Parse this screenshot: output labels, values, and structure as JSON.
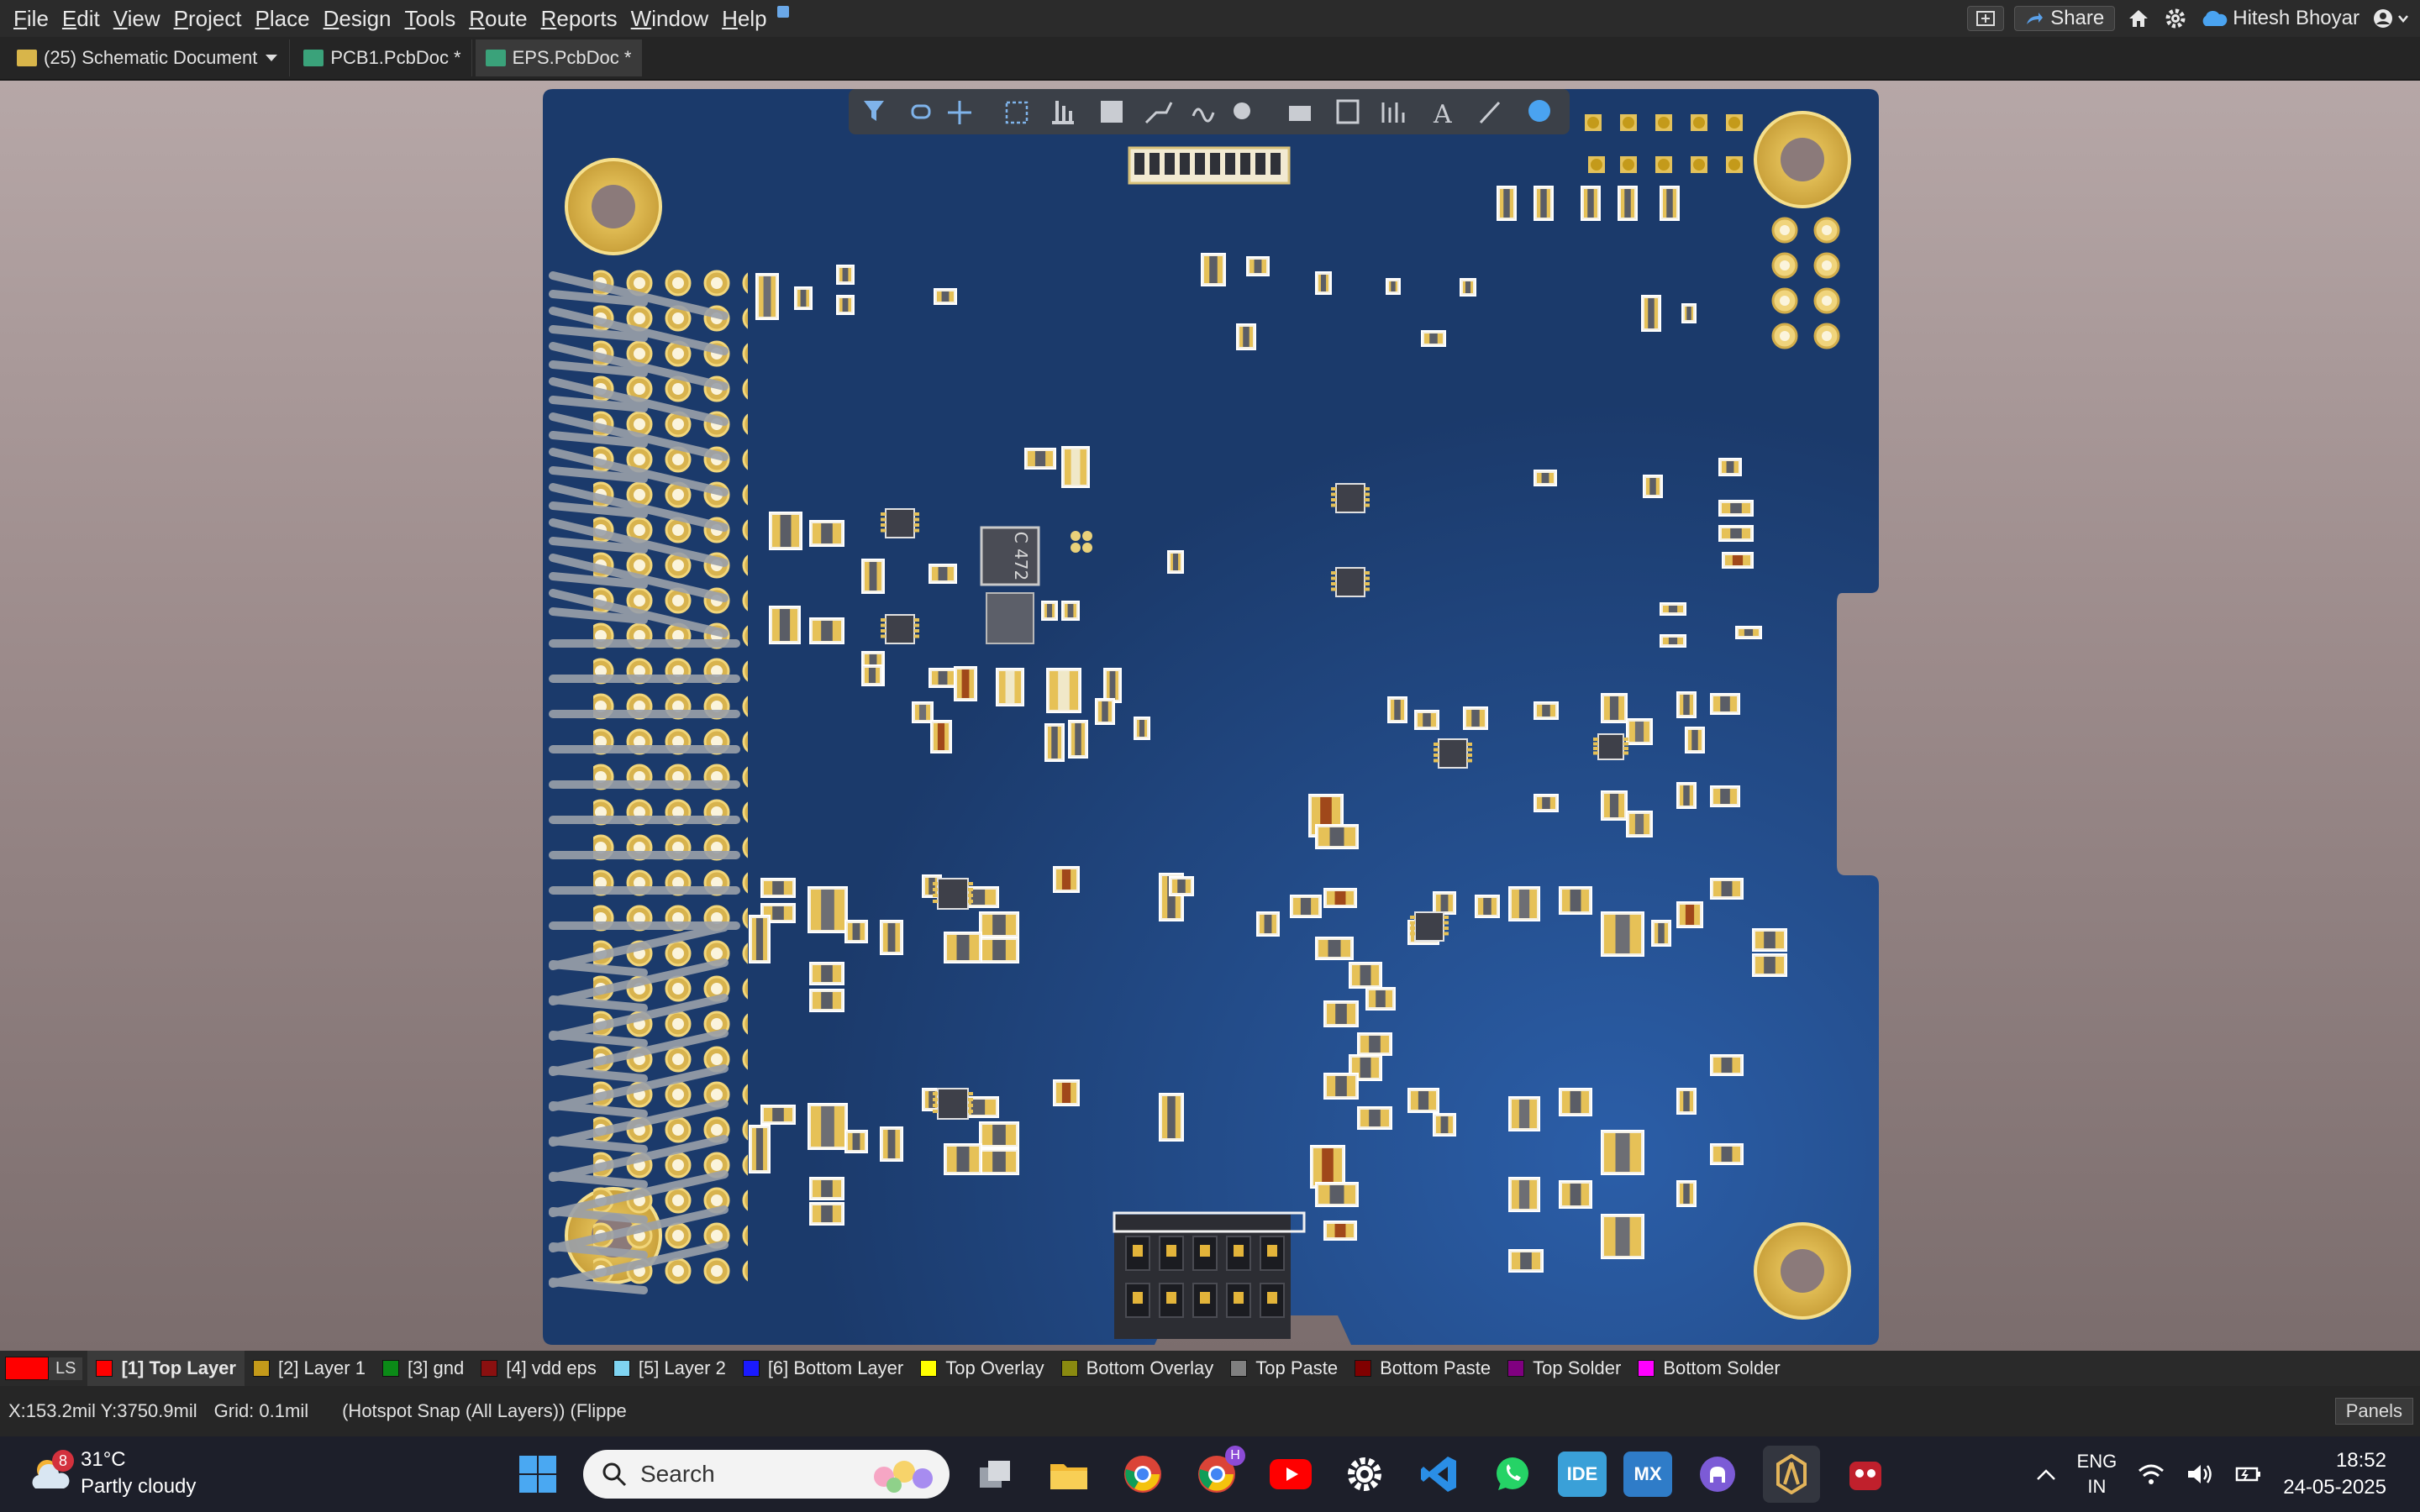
{
  "menu": [
    "File",
    "Edit",
    "View",
    "Project",
    "Place",
    "Design",
    "Tools",
    "Route",
    "Reports",
    "Window",
    "Help"
  ],
  "topright": {
    "share": "Share",
    "user": "Hitesh Bhoyar"
  },
  "tabs": [
    {
      "label": "(25) Schematic Document",
      "color": "#d8b54a"
    },
    {
      "label": "PCB1.PcbDoc *",
      "color": "#3aa27a"
    },
    {
      "label": "EPS.PcbDoc *",
      "color": "#3aa27a"
    }
  ],
  "board": {
    "chip_label": "C\n472"
  },
  "layers": {
    "ls": "LS",
    "items": [
      {
        "label": "[1] Top Layer",
        "color": "#ff0000"
      },
      {
        "label": "[2] Layer 1",
        "color": "#c49a1a"
      },
      {
        "label": "[3] gnd",
        "color": "#0b8a17"
      },
      {
        "label": "[4] vdd eps",
        "color": "#8a1010"
      },
      {
        "label": "[5] Layer 2",
        "color": "#7fd4f2"
      },
      {
        "label": "[6] Bottom Layer",
        "color": "#1a1aff"
      },
      {
        "label": "Top Overlay",
        "color": "#ffff00"
      },
      {
        "label": "Bottom Overlay",
        "color": "#8a8a10"
      },
      {
        "label": "Top Paste",
        "color": "#808080"
      },
      {
        "label": "Bottom Paste",
        "color": "#800000"
      },
      {
        "label": "Top Solder",
        "color": "#800080"
      },
      {
        "label": "Bottom Solder",
        "color": "#ff00ff"
      }
    ]
  },
  "status": {
    "coords": "X:153.2mil Y:3750.9mil",
    "grid": "Grid: 0.1mil",
    "snap": "(Hotspot Snap (All Layers)) (Flippe",
    "panels": "Panels"
  },
  "taskbar": {
    "temp": "31°C",
    "weather": "Partly cloudy",
    "weather_badge": "8",
    "search": "Search",
    "lang1": "ENG",
    "lang2": "IN",
    "time": "18:52",
    "date": "24-05-2025",
    "ide": "IDE",
    "mx": "MX",
    "chrome_badge": "H"
  }
}
